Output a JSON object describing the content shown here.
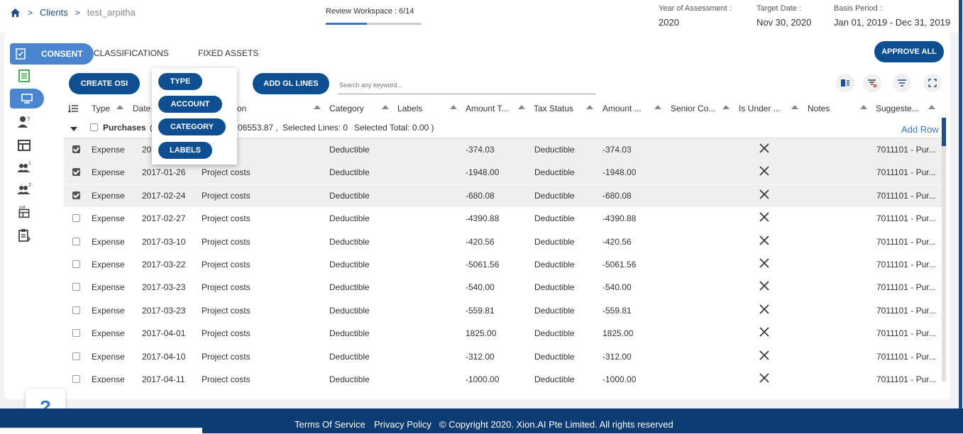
{
  "breadcrumb": {
    "clients": "Clients",
    "current": "test_arpitha"
  },
  "review": {
    "label": "Review Workspace : 6/14",
    "progress": 0.43
  },
  "meta": {
    "year_label": "Year of Assessment :",
    "year_value": "2020",
    "target_label": "Target Date :",
    "target_value": "Nov 30, 2020",
    "basis_label": "Basis Period :",
    "basis_value": "Jan 01, 2019 - Dec 31, 2019"
  },
  "tabs": {
    "consent": "CONSENT",
    "classifications": "CLASSIFICATIONS",
    "fixed_assets": "FIXED ASSETS",
    "approve_all": "APPROVE ALL"
  },
  "toolbar": {
    "create_osi": "CREATE OSI",
    "add_gl_lines": "ADD GL LINES",
    "search_placeholder": "Search any keyword..."
  },
  "dropdown": {
    "type": "TYPE",
    "account": "ACCOUNT",
    "category": "CATEGORY",
    "labels": "LABELS"
  },
  "columns": {
    "type": "Type",
    "date": "Date",
    "description": "on",
    "category": "Category",
    "labels": "Labels",
    "amount_t": "Amount T...",
    "tax_status": "Tax Status",
    "amount": "Amount ...",
    "senior": "Senior Co...",
    "is_under": "Is Under ...",
    "notes": "Notes",
    "suggested": "Suggeste..."
  },
  "group": {
    "name": "Purchases",
    "paren": "(",
    "total": "06553.87 ,",
    "selected_lines": "Selected Lines: 0",
    "selected_total": "Selected Total: 0.00 )"
  },
  "add_row": "Add Row",
  "rows": [
    {
      "checked": true,
      "type": "Expense",
      "date": "20",
      "desc": "ct costs",
      "category": "Deductible",
      "amount_t": "-374.03",
      "tax": "Deductible",
      "amount": "-374.03",
      "suggested": "7011101 - Pur..."
    },
    {
      "checked": true,
      "type": "Expense",
      "date": "2017-01-26",
      "desc": "Project costs",
      "category": "Deductible",
      "amount_t": "-1948.00",
      "tax": "Deductible",
      "amount": "-1948.00",
      "suggested": "7011101 - Pur..."
    },
    {
      "checked": true,
      "type": "Expense",
      "date": "2017-02-24",
      "desc": "Project costs",
      "category": "Deductible",
      "amount_t": "-680.08",
      "tax": "Deductible",
      "amount": "-680.08",
      "suggested": "7011101 - Pur..."
    },
    {
      "checked": false,
      "type": "Expense",
      "date": "2017-02-27",
      "desc": "Project costs",
      "category": "Deductible",
      "amount_t": "-4390.88",
      "tax": "Deductible",
      "amount": "-4390.88",
      "suggested": "7011101 - Pur..."
    },
    {
      "checked": false,
      "type": "Expense",
      "date": "2017-03-10",
      "desc": "Project costs",
      "category": "Deductible",
      "amount_t": "-420.56",
      "tax": "Deductible",
      "amount": "-420.56",
      "suggested": "7011101 - Pur..."
    },
    {
      "checked": false,
      "type": "Expense",
      "date": "2017-03-22",
      "desc": "Project costs",
      "category": "Deductible",
      "amount_t": "-5061.56",
      "tax": "Deductible",
      "amount": "-5061.56",
      "suggested": "7011101 - Pur..."
    },
    {
      "checked": false,
      "type": "Expense",
      "date": "2017-03-23",
      "desc": "Project costs",
      "category": "Deductible",
      "amount_t": "-540.00",
      "tax": "Deductible",
      "amount": "-540.00",
      "suggested": "7011101 - Pur..."
    },
    {
      "checked": false,
      "type": "Expense",
      "date": "2017-03-23",
      "desc": "Project costs",
      "category": "Deductible",
      "amount_t": "-559.81",
      "tax": "Deductible",
      "amount": "-559.81",
      "suggested": "7011101 - Pur..."
    },
    {
      "checked": false,
      "type": "Expense",
      "date": "2017-04-01",
      "desc": "Project costs",
      "category": "Deductible",
      "amount_t": "1825.00",
      "tax": "Deductible",
      "amount": "1825.00",
      "suggested": "7011101 - Pur..."
    },
    {
      "checked": false,
      "type": "Expense",
      "date": "2017-04-10",
      "desc": "Project costs",
      "category": "Deductible",
      "amount_t": "-312.00",
      "tax": "Deductible",
      "amount": "-312.00",
      "suggested": "7011101 - Pur..."
    },
    {
      "checked": false,
      "type": "Expense",
      "date": "2017-04-11",
      "desc": "Project costs",
      "category": "Deductible",
      "amount_t": "-1000.00",
      "tax": "Deductible",
      "amount": "-1000.00",
      "suggested": "7011101 - Pur..."
    }
  ],
  "help": "?",
  "footer": {
    "terms": "Terms Of Service",
    "privacy": "Privacy Policy",
    "copyright": "© Copyright 2020. Xion.AI Pte Limited. All rights reserved"
  },
  "colors": {
    "primary": "#0d4f91",
    "accent": "#4a86cf",
    "footer": "#0d3b73"
  }
}
